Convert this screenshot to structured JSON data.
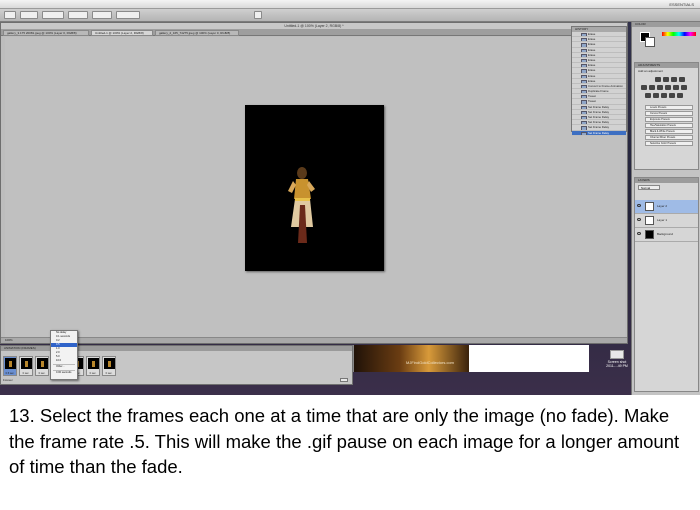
{
  "menubar": {
    "workspace": "ESSENTIALS"
  },
  "document": {
    "title": "Untitled-1 @ 100% (Layer 2, RGB/8) *",
    "tabs": [
      "gallery_3.175 20081.jpeg @ 100% (Layer 0, RGB/8)",
      "Untitled-1 @ 100% (Layer 2, RGB/8)",
      "gallery_2_165_74275.jpeg @ 100% (Layer 0, RGB/8)"
    ],
    "status": "100%"
  },
  "history": {
    "title": "HISTORY",
    "items": [
      "Erase",
      "Erase",
      "Erase",
      "Erase",
      "Erase",
      "Erase",
      "Erase",
      "Erase",
      "Erase",
      "Erase",
      "Convert to Frame Animation",
      "Duplicate Frame",
      "Tween",
      "Tween",
      "Set Frame Delay",
      "Set Frame Delay",
      "Set Frame Delay",
      "Set Frame Delay",
      "Set Frame Delay",
      "Set Frame Delay"
    ],
    "selected_index": 19
  },
  "panels": {
    "color_tab": "COLOR",
    "adjustments_tab": "ADJUSTMENTS",
    "adjustments_hint": "Add an adjustment",
    "presets": [
      "Levels Presets",
      "Curves Presets",
      "Exposure Presets",
      "Hue/Saturation Presets",
      "Black & White Presets",
      "Channel Mixer Presets",
      "Selective Color Presets"
    ],
    "layers_tab": "LAYERS",
    "blend_mode": "Normal",
    "layers": [
      "Layer 2",
      "Layer 1",
      "Background"
    ]
  },
  "animation": {
    "title": "ANIMATION (FRAMES)",
    "frame_delays": [
      "0.5 sec.",
      "0 sec.",
      "0 sec.",
      "0 sec.",
      "0 sec.",
      "0 sec."
    ],
    "loop": "Forever"
  },
  "delay_menu": {
    "items": [
      "No delay",
      "0.1 seconds",
      "0.2",
      "0.5",
      "1.0",
      "2.0",
      "5.0",
      "10.0",
      "Other...",
      "0.00 seconds"
    ],
    "selected_index": 3
  },
  "background_window": {
    "credit": "MJFindGoldCollectors.com"
  },
  "desktop": {
    "icon_label": "Screen shot 2011-...49 PM"
  },
  "caption": "13. Select the frames each one at a time that are only the image (no fade). Make the frame rate .5. This will make the .gif pause on each image for a longer amount of time than the fade."
}
